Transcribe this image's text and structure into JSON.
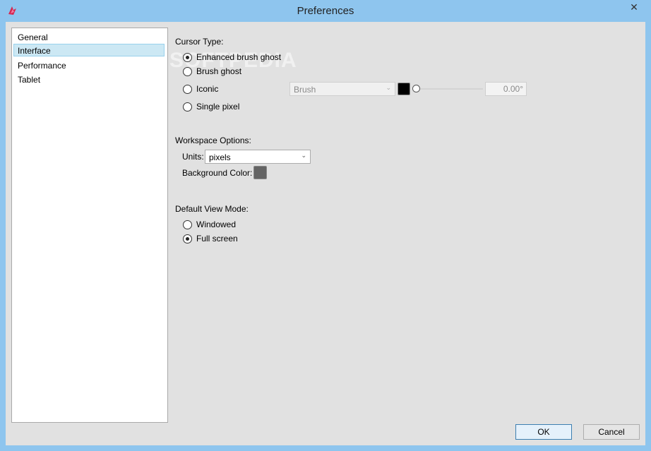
{
  "window": {
    "title": "Preferences",
    "close_glyph": "✕"
  },
  "nav": {
    "items": [
      {
        "label": "General"
      },
      {
        "label": "Interface"
      },
      {
        "label": "Performance"
      },
      {
        "label": "Tablet"
      }
    ],
    "selected": "Interface"
  },
  "cursor": {
    "heading": "Cursor Type:",
    "options": [
      {
        "label": "Enhanced brush ghost",
        "checked": true
      },
      {
        "label": "Brush ghost",
        "checked": false
      },
      {
        "label": "Iconic",
        "checked": false
      },
      {
        "label": "Single pixel",
        "checked": false
      }
    ],
    "icon_combo_value": "Brush",
    "icon_color": "#000000",
    "angle_value": "0.00°",
    "angle_slider_fraction": 0
  },
  "workspace": {
    "heading": "Workspace Options:",
    "units_label": "Units:",
    "units_value": "pixels",
    "bg_color_label": "Background Color:",
    "bg_color": "#646464"
  },
  "view_mode": {
    "heading": "Default View Mode:",
    "options": [
      {
        "label": "Windowed",
        "checked": false
      },
      {
        "label": "Full screen",
        "checked": true
      }
    ]
  },
  "buttons": {
    "ok": "OK",
    "cancel": "Cancel"
  },
  "watermark": "SOFTPEDIA"
}
